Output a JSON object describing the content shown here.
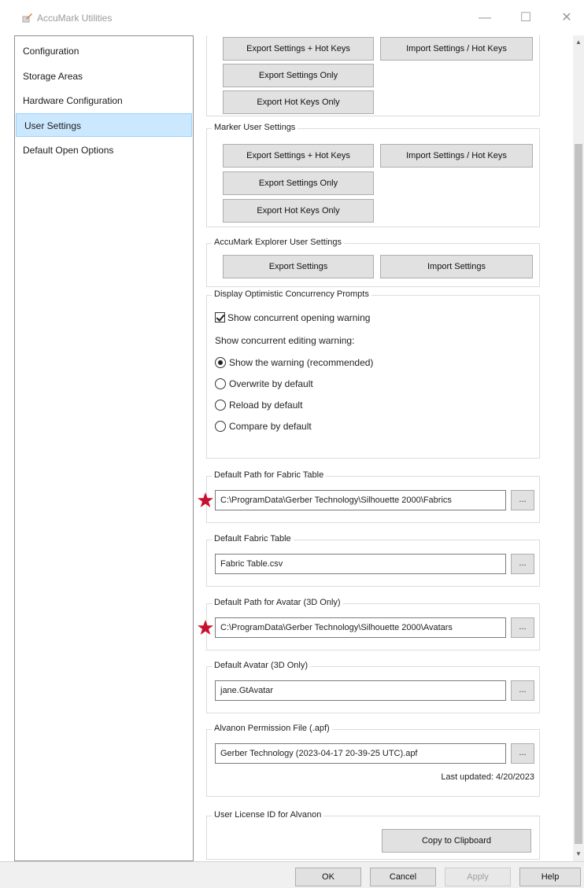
{
  "window": {
    "title": "AccuMark Utilities",
    "minimize_icon": "minimize-icon",
    "maximize_icon": "maximize-icon",
    "close_icon": "close-icon"
  },
  "sidebar": {
    "items": [
      {
        "label": "Configuration",
        "active": false
      },
      {
        "label": "Storage Areas",
        "active": false
      },
      {
        "label": "Hardware Configuration",
        "active": false
      },
      {
        "label": "User Settings",
        "active": true
      },
      {
        "label": "Default Open Options",
        "active": false
      }
    ]
  },
  "content": {
    "top_group": {
      "export_settings_hotkeys": "Export Settings + Hot Keys",
      "import_settings_hotkeys": "Import Settings / Hot Keys",
      "export_settings_only": "Export Settings Only",
      "export_hotkeys_only": "Export Hot Keys Only"
    },
    "marker_group": {
      "label": "Marker User Settings",
      "export_settings_hotkeys": "Export Settings + Hot Keys",
      "import_settings_hotkeys": "Import Settings / Hot Keys",
      "export_settings_only": "Export Settings Only",
      "export_hotkeys_only": "Export Hot Keys Only"
    },
    "explorer_group": {
      "label": "AccuMark Explorer User Settings",
      "export_settings": "Export Settings",
      "import_settings": "Import Settings"
    },
    "concurrency_group": {
      "label": "Display Optimistic Concurrency Prompts",
      "checkbox_label": "Show concurrent opening warning",
      "checkbox_checked": true,
      "editing_label": "Show concurrent editing warning:",
      "radios": [
        {
          "label": "Show the warning (recommended)",
          "selected": true
        },
        {
          "label": "Overwrite by default",
          "selected": false
        },
        {
          "label": "Reload by default",
          "selected": false
        },
        {
          "label": "Compare by default",
          "selected": false
        }
      ]
    },
    "fabric_path": {
      "label": "Default Path for Fabric Table",
      "value": "C:\\ProgramData\\Gerber Technology\\Silhouette 2000\\Fabrics",
      "browse": "..."
    },
    "fabric_table": {
      "label": "Default Fabric Table",
      "value": "Fabric Table.csv",
      "browse": "..."
    },
    "avatar_path": {
      "label": "Default Path for Avatar (3D Only)",
      "value": "C:\\ProgramData\\Gerber Technology\\Silhouette 2000\\Avatars",
      "browse": "..."
    },
    "default_avatar": {
      "label": "Default Avatar (3D Only)",
      "value": "jane.GtAvatar",
      "browse": "..."
    },
    "alvanon_file": {
      "label": "Alvanon Permission File (.apf)",
      "value": "Gerber Technology (2023-04-17 20-39-25 UTC).apf",
      "browse": "...",
      "last_updated": "Last updated: 4/20/2023"
    },
    "license_group": {
      "label": "User License ID for Alvanon",
      "copy_button": "Copy to Clipboard"
    },
    "annotation_color": "#c8102e"
  },
  "footer": {
    "ok": "OK",
    "cancel": "Cancel",
    "apply": "Apply",
    "help": "Help"
  }
}
